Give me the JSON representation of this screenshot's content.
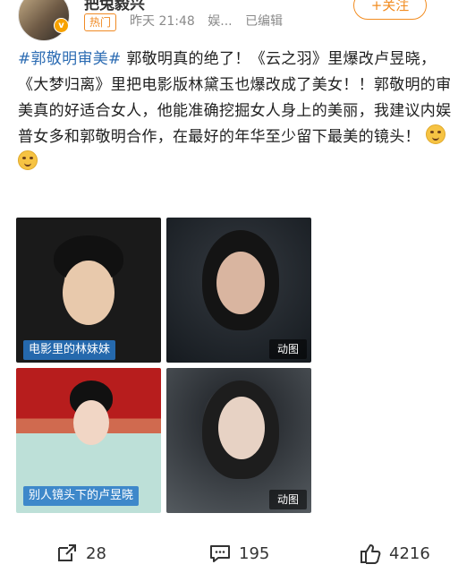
{
  "header": {
    "username": "把兔毅兴",
    "hot_badge": "热门",
    "time": "昨天 21:48",
    "source": "娱...",
    "edited": "已编辑",
    "follow_label": "+关注"
  },
  "post": {
    "hashtag": "#郭敬明审美#",
    "text": "郭敬明真的绝了！《云之羽》里爆改卢昱晓，《大梦归离》里把电影版林黛玉也爆改成了美女！！郭敬明的审美真的好适合女人，他能准确挖掘女人身上的美丽，我建议内娱普女多和郭敬明合作，在最好的年华至少留下最美的镜头！"
  },
  "images": [
    {
      "caption": "电影里的林妹妹"
    },
    {
      "badge": "动图"
    },
    {
      "caption": "别人镜头下的卢昱晓"
    },
    {
      "badge": "动图"
    }
  ],
  "actions": {
    "repost_count": "28",
    "comment_count": "195",
    "like_count": "4216"
  },
  "icons": [
    "avatar",
    "verified-badge-icon",
    "emoji-icon",
    "repost-icon",
    "comment-icon",
    "like-icon"
  ],
  "colors": {
    "hashtag": "#2c6cb3",
    "follow": "#f28c20",
    "hot": "#f08a24"
  }
}
